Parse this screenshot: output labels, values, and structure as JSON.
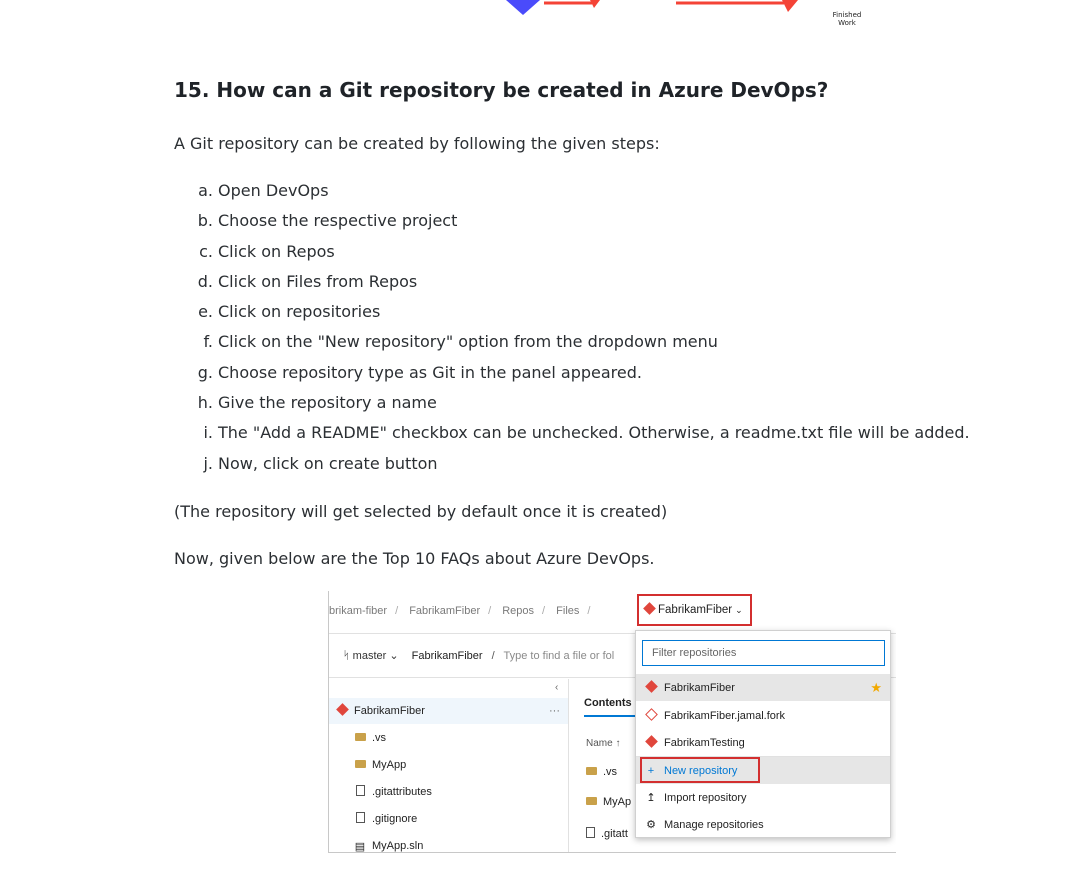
{
  "diagram": {
    "finished_label": [
      "Finished",
      "Work"
    ]
  },
  "article": {
    "heading": "15. How can a Git repository be created in Azure DevOps?",
    "intro": "A Git repository can be created by following the given steps:",
    "steps": [
      {
        "marker": "a.",
        "text": "Open DevOps"
      },
      {
        "marker": "b.",
        "text": "Choose the respective project"
      },
      {
        "marker": "c.",
        "text": "Click on Repos"
      },
      {
        "marker": "d.",
        "text": "Click on Files from Repos"
      },
      {
        "marker": "e.",
        "text": "Click on repositories"
      },
      {
        "marker": "f.",
        "text": "Click on the \"New repository\" option from the dropdown menu"
      },
      {
        "marker": "g.",
        "text": "Choose repository type as Git in the panel appeared."
      },
      {
        "marker": "h.",
        "text": "Give the repository a name"
      },
      {
        "marker": "i.",
        "text": "The \"Add a README\" checkbox can be unchecked. Otherwise, a readme.txt file will be added."
      },
      {
        "marker": "j.",
        "text": "Now, click on create button"
      }
    ],
    "note": "(The repository will get selected by default once it is created)",
    "faq_intro": "Now, given below are the Top 10 FAQs about Azure DevOps."
  },
  "screenshot": {
    "breadcrumb": [
      "brikam-fiber",
      "FabrikamFiber",
      "Repos",
      "Files"
    ],
    "repo_selector": "FabrikamFiber",
    "branch": "master",
    "path": "FabrikamFiber",
    "find_placeholder": "Type to find a file or fol",
    "tree": {
      "root": "FabrikamFiber",
      "items": [
        {
          "name": ".vs",
          "kind": "folder"
        },
        {
          "name": "MyApp",
          "kind": "folder"
        },
        {
          "name": ".gitattributes",
          "kind": "file"
        },
        {
          "name": ".gitignore",
          "kind": "file"
        },
        {
          "name": "MyApp.sln",
          "kind": "solution"
        }
      ]
    },
    "contents_tab": "Contents",
    "name_column": "Name ↑",
    "main_rows": [
      ".vs",
      "MyAp",
      ".gitatt"
    ],
    "dropdown": {
      "filter_placeholder": "Filter repositories",
      "repos": [
        "FabrikamFiber",
        "FabrikamFiber.jamal.fork",
        "FabrikamTesting"
      ],
      "actions": [
        "New repository",
        "Import repository",
        "Manage repositories"
      ]
    },
    "colors": {
      "highlight_red": "#d32f2f",
      "accent_blue": "#0078d4",
      "git_orange": "#e0463c"
    }
  }
}
